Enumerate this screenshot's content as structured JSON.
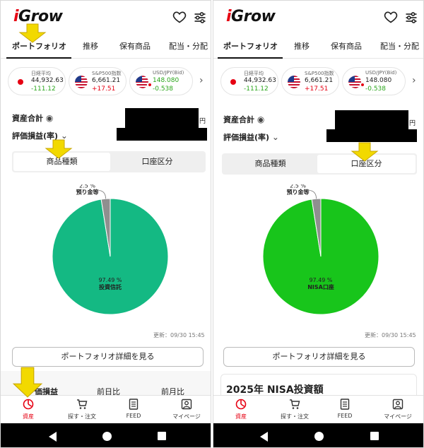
{
  "app": {
    "logo": "iGrow",
    "logo_head": "iGrow"
  },
  "tabs": [
    "ポートフォリオ",
    "推移",
    "保有商品",
    "配当・分配"
  ],
  "markets": [
    {
      "name": "日経平均",
      "value": "44,932.63",
      "change": "-111.12",
      "flag": "japan-flag-icon"
    },
    {
      "name": "S&P500指数",
      "value": "6,661.21",
      "change": "+17.51",
      "flag": "usa-flag-icon"
    },
    {
      "name": "USD/JPY(Bid)",
      "value": "148.080",
      "change": "-0.538",
      "flag": "usd-jpy-flag-icon"
    }
  ],
  "summary": {
    "total_assets_label": "資産合計",
    "yen": "円",
    "pnl_label": "評価損益(率)"
  },
  "segment": {
    "product_type": "商品種類",
    "account_type": "口座区分"
  },
  "left_panel": {
    "chart_data": {
      "type": "pie",
      "slices": [
        {
          "label": "投資信託",
          "value": 97.49,
          "percent_text": "97.49 %",
          "color": "#14b983"
        },
        {
          "label": "預り金等",
          "value": 2.5,
          "percent_text": "2.5 %",
          "color": "#8f8f8f"
        }
      ]
    }
  },
  "right_panel": {
    "chart_data": {
      "type": "pie",
      "slices": [
        {
          "label": "NISA口座",
          "value": 97.49,
          "percent_text": "97.49 %",
          "color": "#18c51b"
        },
        {
          "label": "預り金等",
          "value": 2.5,
          "percent_text": "2.5 %",
          "color": "#8f8f8f"
        }
      ]
    }
  },
  "update_text": "更新：09/30 15:45",
  "detail_button": "ポートフォリオ詳細を見る",
  "left_bottom_tabs": [
    "価損益",
    "前日比",
    "前月比"
  ],
  "nisa_section_title": "2025年 NISA投資額",
  "bottom_nav": [
    {
      "label": "資産",
      "icon": "pie-chart-icon",
      "active": true
    },
    {
      "label": "探す・注文",
      "icon": "cart-icon",
      "active": false
    },
    {
      "label": "FEED",
      "icon": "document-icon",
      "active": false
    },
    {
      "label": "マイページ",
      "icon": "profile-icon",
      "active": false
    }
  ],
  "colors": {
    "accent": "#e60012",
    "highlight_arrow": "#f2d900",
    "positive": "#e60012",
    "negative": "#2aa61b"
  }
}
